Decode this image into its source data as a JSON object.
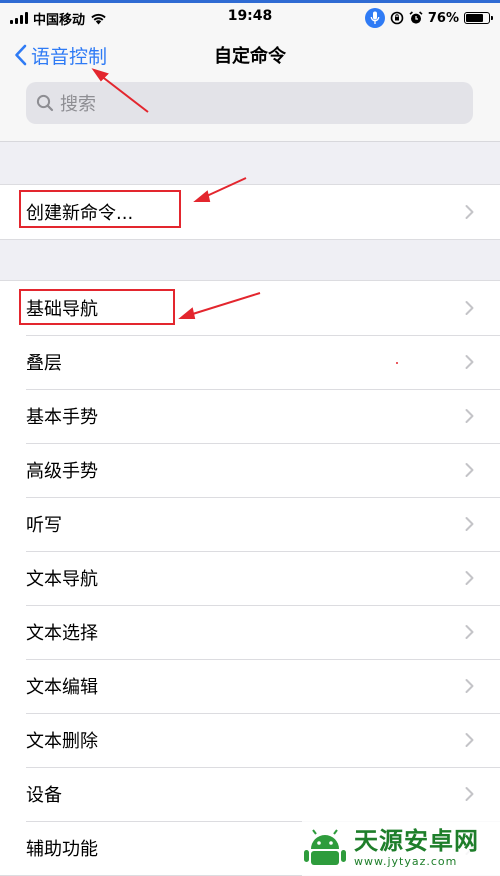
{
  "status_bar": {
    "carrier": "中国移动",
    "time": "19:48",
    "battery": "76%",
    "battery_level": 0.76
  },
  "nav": {
    "back_label": "语音控制",
    "title": "自定命令",
    "search_placeholder": "搜索"
  },
  "create_command": {
    "label": "创建新命令..."
  },
  "categories": [
    "基础导航",
    "叠层",
    "基本手势",
    "高级手势",
    "听写",
    "文本导航",
    "文本选择",
    "文本编辑",
    "文本删除",
    "设备",
    "辅助功能"
  ],
  "watermark": {
    "name": "天源安卓网",
    "url": "www.jytyaz.com"
  },
  "colors": {
    "accent": "#2f7bf5",
    "annotation_red": "#e3262e",
    "background": "#efeff4"
  }
}
